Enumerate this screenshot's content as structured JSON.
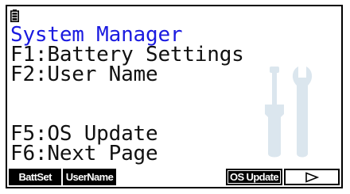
{
  "screen": {
    "title": "System Manager",
    "menu_items": [
      "F1:Battery Settings",
      "F2:User Name",
      "F5:OS Update",
      "F6:Next Page"
    ]
  },
  "status_bar": {
    "icon": "battery-icon"
  },
  "function_keys": [
    {
      "label": "BattSet",
      "style": "filled"
    },
    {
      "label": "UserName",
      "style": "filled"
    },
    {
      "label": "",
      "style": "blank"
    },
    {
      "label": "",
      "style": "blank"
    },
    {
      "label": "OS Update",
      "style": "outlined"
    },
    {
      "label": "",
      "icon": "right-arrow-icon",
      "style": "outlined"
    }
  ],
  "colors": {
    "title": "#1a1ae0",
    "text": "#111111",
    "watermark": "#dbe6ee"
  },
  "watermark_icon": "tools-icon"
}
